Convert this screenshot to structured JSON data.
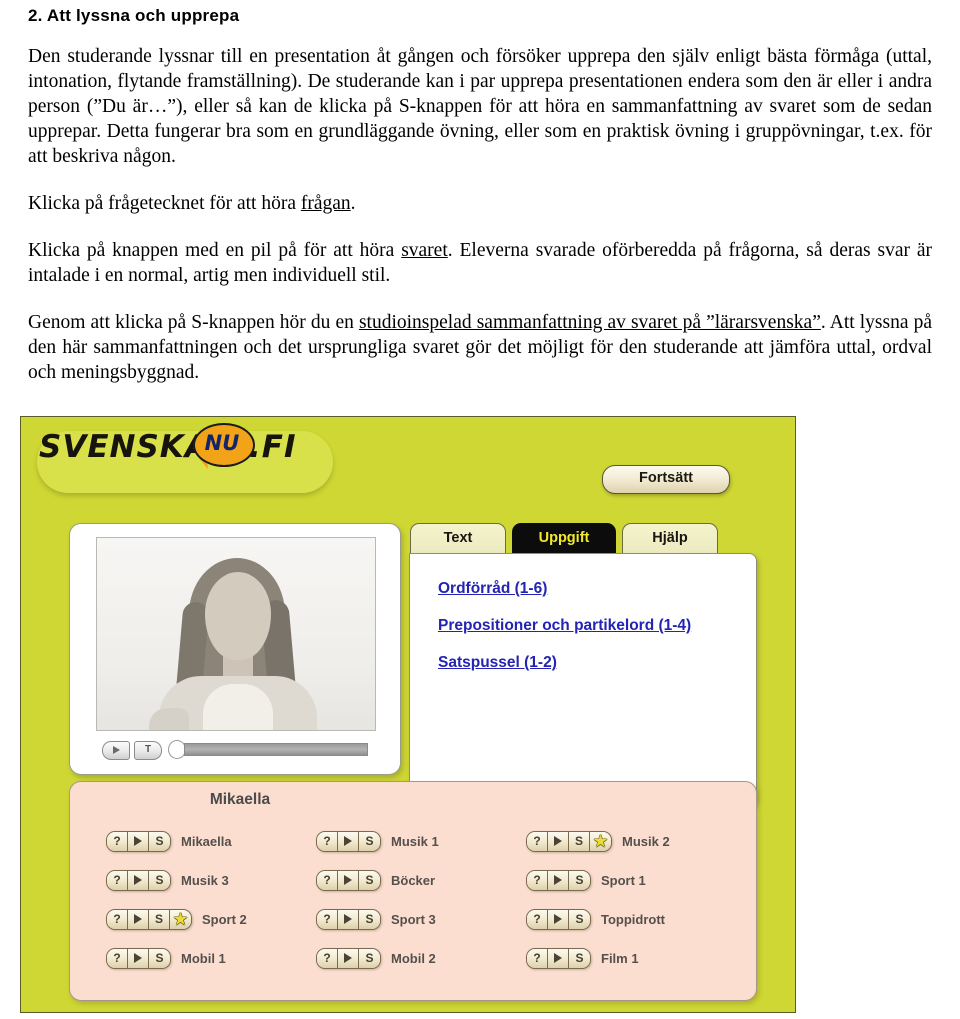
{
  "document": {
    "heading": "2. Att lyssna och upprepa",
    "paragraphs": [
      "Den studerande lyssnar till en presentation åt gången och försöker upprepa den själv enligt bästa förmåga (uttal, intonation, flytande framställning). De studerande kan i par upprepa presentationen endera som den är eller i andra person (”Du är…”), eller så kan de klicka på S-knappen för att höra en sammanfattning av svaret som de sedan upprepar. Detta fungerar bra som en grundläggande övning, eller som en praktisk övning i gruppövningar, t.ex. för att beskriva någon.",
      "Klicka på frågetecknet för att höra frågan.",
      "Klicka på knappen med en pil på för att höra svaret. Eleverna svarade oförberedda på frågorna, så deras svar är intalade i en normal, artig men individuell stil.",
      "Genom att klicka på S-knappen hör du en studioinspelad sammanfattning av svaret på ”lärarsvenska”. Att lyssna på den här sammanfattningen och det ursprungliga svaret gör det möjligt för den studerande att jämföra uttal, ordval och meningsbyggnad."
    ],
    "p2_pre": "Klicka på frågetecknet för att höra ",
    "p2_underlined": "frågan",
    "p2_post": ".",
    "p3_pre": "Klicka på knappen med en pil på för att höra ",
    "p3_underlined": "svaret",
    "p3_post": ". Eleverna svarade oförberedda på frågorna, så deras svar är intalade i en normal, artig men individuell stil.",
    "p4_pre": "Genom att klicka på S-knappen hör du en ",
    "p4_underlined": "studioinspelad sammanfattning av svaret på ”lärarsvenska”",
    "p4_post": ". Att lyssna på den här sammanfattningen och det ursprungliga svaret gör det möjligt för den studerande att jämföra uttal, ordval och meningsbyggnad."
  },
  "app": {
    "logo": {
      "main": "SVENSKA",
      "bubble": "NU",
      "suffix": ".FI"
    },
    "continue_button": "Fortsätt",
    "tabs": [
      {
        "label": "Text",
        "active": false
      },
      {
        "label": "Uppgift",
        "active": true
      },
      {
        "label": "Hjälp",
        "active": false
      }
    ],
    "exercise_links": [
      "Ordförråd (1-6)",
      "Prepositioner och partikelord (1-4)",
      "Satspussel (1-2)"
    ],
    "video": {
      "play_icon": "play-triangle",
      "text_button": "T",
      "progress_percent": 0
    },
    "clips_panel": {
      "title": "Mikaella",
      "button_question": "?",
      "button_play": "play-triangle",
      "button_summary": "S",
      "button_star": "star",
      "items": [
        {
          "label": "Mikaella",
          "has_star": false
        },
        {
          "label": "Musik 1",
          "has_star": false
        },
        {
          "label": "Musik 2",
          "has_star": true
        },
        {
          "label": "Musik 3",
          "has_star": false
        },
        {
          "label": "Böcker",
          "has_star": false
        },
        {
          "label": "Sport 1",
          "has_star": false
        },
        {
          "label": "Sport 2",
          "has_star": true
        },
        {
          "label": "Sport 3",
          "has_star": false
        },
        {
          "label": "Toppidrott",
          "has_star": false
        },
        {
          "label": "Mobil 1",
          "has_star": false
        },
        {
          "label": "Mobil 2",
          "has_star": false
        },
        {
          "label": "Film 1",
          "has_star": false
        }
      ]
    },
    "colors": {
      "background_green": "#cfd734",
      "logo_pill": "#d8e04a",
      "bubble_orange": "#f2a317",
      "bubble_text": "#12246c",
      "active_tab_bg": "#0c0c0c",
      "active_tab_text": "#f2e92a",
      "link_blue": "#2323b4",
      "clips_panel_pink": "#fbded0",
      "star_yellow": "#ecdc32"
    }
  }
}
